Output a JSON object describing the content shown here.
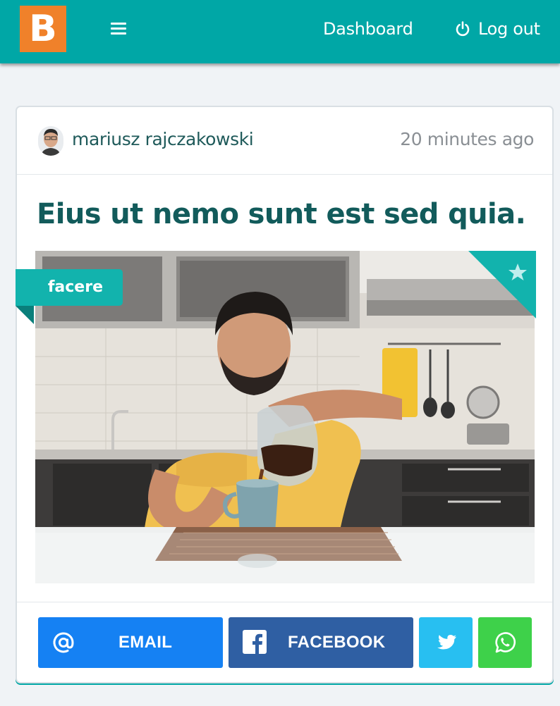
{
  "header": {
    "logo_letter": "B",
    "menu_icon": "hamburger-icon",
    "nav": {
      "dashboard_label": "Dashboard",
      "logout_label": "Log out",
      "logout_icon": "power-icon"
    },
    "colors": {
      "bar": "#00a7a6",
      "logo": "#f0812a"
    }
  },
  "post": {
    "author": "mariusz rajczakowski",
    "time_ago": "20 minutes ago",
    "title": "Eius ut nemo sunt est sed quia.",
    "tag": "facere",
    "featured_icon": "star-icon",
    "image": "man-pouring-coffee-in-kitchen-photo",
    "title_color": "#125b5b",
    "tag_color": "#12b3ad"
  },
  "share": {
    "email": {
      "label": "EMAIL",
      "icon": "at-icon",
      "color": "#1581f3"
    },
    "facebook": {
      "label": "FACEBOOK",
      "icon": "facebook-icon",
      "color": "#2f5fa3"
    },
    "twitter": {
      "icon": "twitter-icon",
      "color": "#28bff1"
    },
    "whatsapp": {
      "icon": "whatsapp-icon",
      "color": "#3ed14a"
    }
  }
}
